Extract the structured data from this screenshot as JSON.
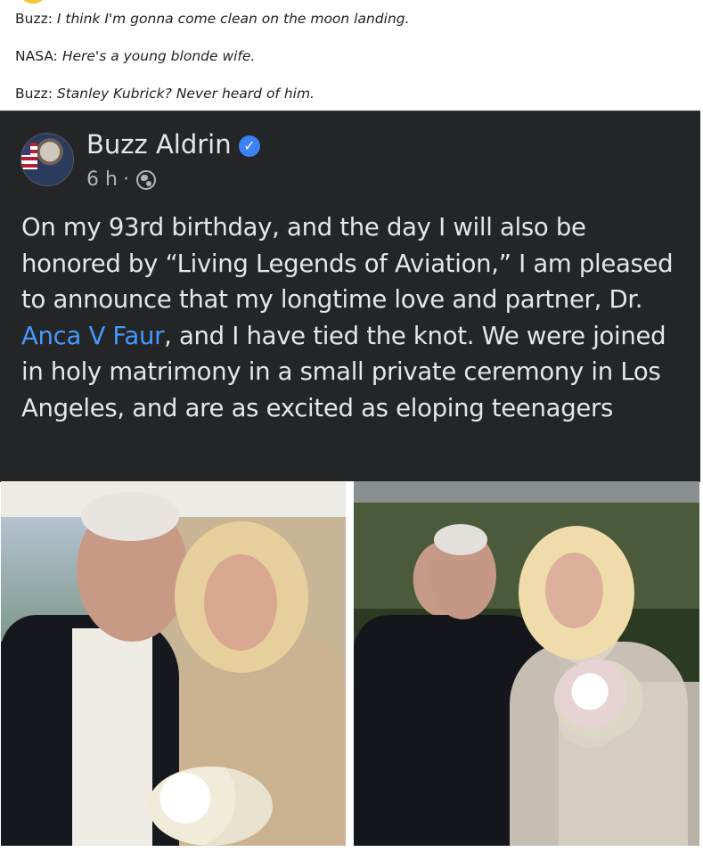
{
  "meme": {
    "lines": [
      {
        "speaker": "Buzz:",
        "text": "I think I'm gonna come clean on the moon landing."
      },
      {
        "speaker": "NASA:",
        "text": "Here's a young blonde wife."
      },
      {
        "speaker": "Buzz:",
        "text": "Stanley Kubrick? Never heard of him."
      }
    ]
  },
  "post": {
    "author": "Buzz Aldrin",
    "verified_icon": "verified-badge-icon",
    "time": "6 h",
    "separator": "·",
    "audience_icon": "globe-icon",
    "text_before_mention": "On my 93rd birthday, and the day I will also be honored by “Living Legends of Aviation,” I am pleased to announce that my longtime love and partner, Dr. ",
    "mention": "Anca V Faur",
    "text_after_mention": ", and I have tied the knot. We were joined in holy matrimony in a small private ceremony in Los Angeles, and are as excited as eloping teenagers",
    "colors": {
      "background": "#242526",
      "text": "#e4e6eb",
      "secondary_text": "#b0b3b8",
      "mention": "#4599ff",
      "verified": "#3b82f6"
    }
  }
}
